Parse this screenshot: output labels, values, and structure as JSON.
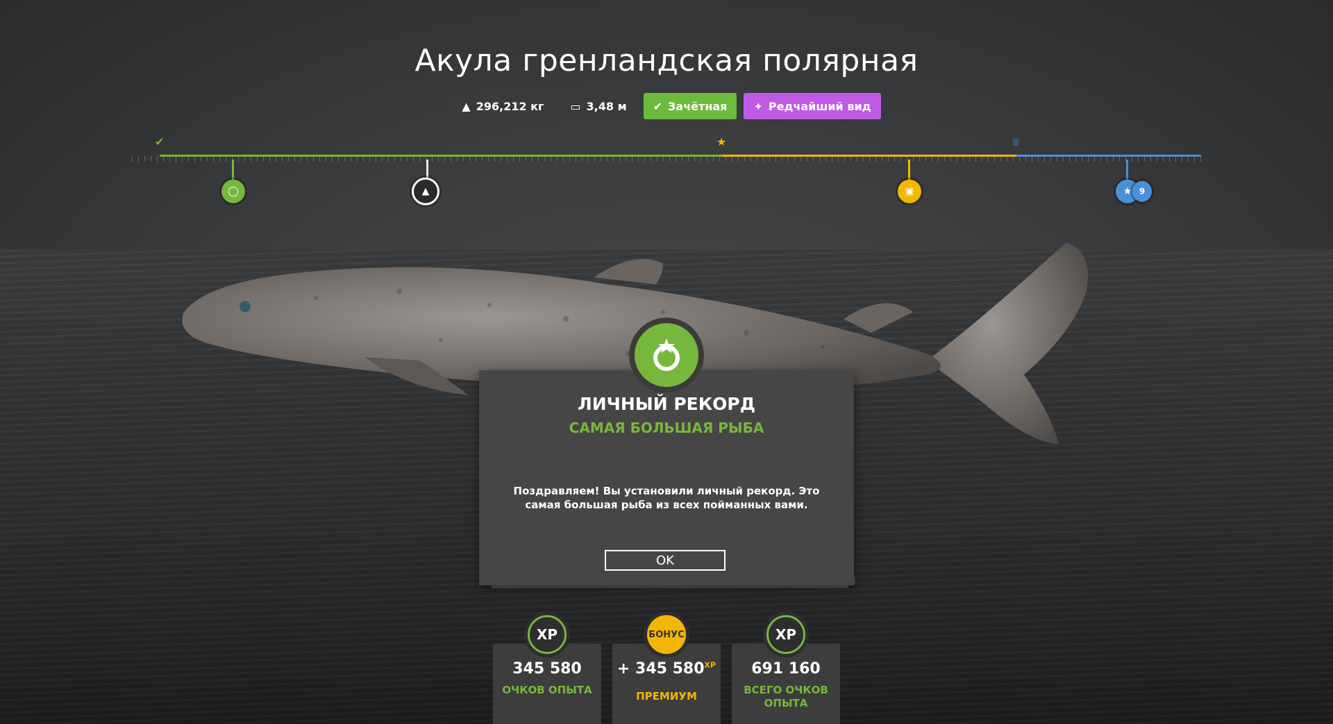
{
  "fish": {
    "name": "Акула гренландская полярная",
    "weight": "296,212 кг",
    "length": "3,48 м",
    "trophy_label": "Зачётная",
    "rarity_label": "Редчайший вид"
  },
  "colors": {
    "green": "#76b83c",
    "gold": "#f2b705",
    "blue": "#4a90d9",
    "purple": "#c05ae6"
  },
  "record_dialog": {
    "title": "ЛИЧНЫЙ РЕКОРД",
    "subtitle": "САМАЯ БОЛЬШАЯ РЫБА",
    "message": "Поздравляем! Вы установили личный рекорд. Это самая большая рыба из всех пойманных вами.",
    "ok_label": "OK"
  },
  "rewards": {
    "base": {
      "icon_text": "XP",
      "value": "345 580",
      "label": "ОЧКОВ ОПЫТА"
    },
    "bonus": {
      "icon_text": "БОНУС",
      "value": "+ 345 580",
      "suffix": "XP",
      "label": "ПРЕМИУМ"
    },
    "total": {
      "icon_text": "XP",
      "value": "691 160",
      "label": "ВСЕГО ОЧКОВ ОПЫТА"
    }
  }
}
